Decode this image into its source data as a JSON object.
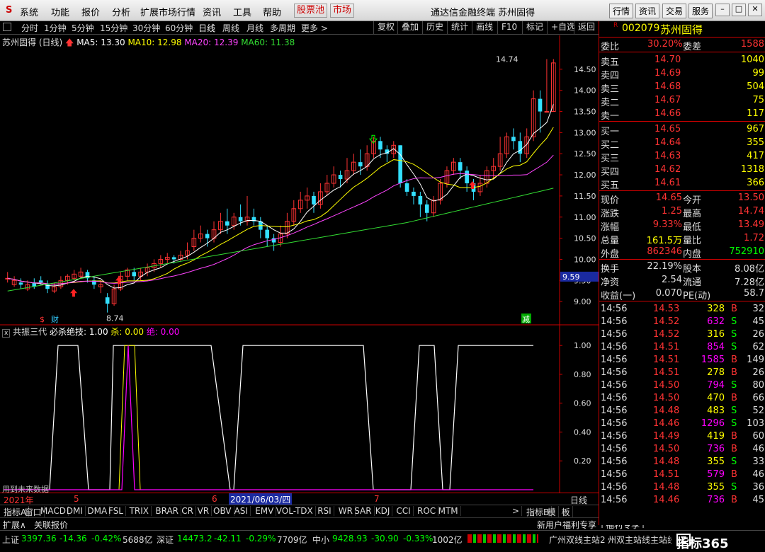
{
  "menu": {
    "items": [
      "系统",
      "功能",
      "报价",
      "分析",
      "扩展市场行情",
      "资讯",
      "工具",
      "帮助"
    ],
    "special": [
      "股票池",
      "市场"
    ],
    "title": "通达信金融终端  苏州固得",
    "right_buttons": [
      "行情",
      "资讯",
      "交易",
      "服务"
    ]
  },
  "toolbar": {
    "periods": [
      "分时",
      "1分钟",
      "5分钟",
      "15分钟",
      "30分钟",
      "60分钟",
      "日线",
      "周线",
      "月线",
      "多周期",
      "更多 >"
    ],
    "tools": [
      "复权",
      "叠加",
      "历史",
      "统计",
      "画线",
      "F10",
      "标记",
      "+自选",
      "返回"
    ]
  },
  "chart_header": {
    "name": "苏州固得 (日线)",
    "ma5": "MA5: 13.30",
    "ma10": "MA10: 12.98",
    "ma20": "MA20: 12.39",
    "ma60": "MA60: 11.38"
  },
  "price_axis": [
    "14.50",
    "14.00",
    "13.50",
    "13.00",
    "12.50",
    "12.00",
    "11.50",
    "11.00",
    "10.50",
    "10.00",
    "9.50",
    "9.00"
  ],
  "price_cursor": "9.59",
  "high_label": "14.74",
  "low_label": "8.74",
  "markers": {
    "s": "$",
    "cai": "财",
    "jian": "减"
  },
  "indicator_header": {
    "name": "共振三代",
    "bisha": "必杀绝技: 1.00",
    "sha": "杀: 0.00",
    "jue": "绝: 0.00"
  },
  "ind_axis": [
    "1.00",
    "0.80",
    "0.60",
    "0.40",
    "0.20"
  ],
  "ind_note": "用到未来数据",
  "date_axis": {
    "y2021": "2021年",
    "m5": "5",
    "m6": "6",
    "cursor_date": "2021/06/03/四",
    "m7": "7",
    "period": "日线"
  },
  "bottom_tabs": [
    "指标A",
    "窗口",
    "MACD",
    "DMI",
    "DMA",
    "FSL",
    "TRIX",
    "BRAR",
    "CR",
    "VR",
    "OBV",
    "ASI",
    "EMV",
    "VOL-TDX",
    "RSI",
    "WR",
    "SAR",
    "KDJ",
    "CCI",
    "ROC",
    "MTM",
    ">",
    "指标B",
    "模",
    "板"
  ],
  "bottom_row2": [
    "扩展∧",
    "关联报价"
  ],
  "bottom_ticker": "新用户福利专享",
  "stock": {
    "code": "002079",
    "name": "苏州固得",
    "flag": "R"
  },
  "weibi": {
    "label": "委比",
    "value": "30.20%",
    "wc_label": "委差",
    "wc_value": "1588"
  },
  "sell": [
    {
      "label": "卖五",
      "price": "14.70",
      "vol": "1040"
    },
    {
      "label": "卖四",
      "price": "14.69",
      "vol": "99"
    },
    {
      "label": "卖三",
      "price": "14.68",
      "vol": "504"
    },
    {
      "label": "卖二",
      "price": "14.67",
      "vol": "75"
    },
    {
      "label": "卖一",
      "price": "14.66",
      "vol": "117"
    }
  ],
  "buy": [
    {
      "label": "买一",
      "price": "14.65",
      "vol": "967"
    },
    {
      "label": "买二",
      "price": "14.64",
      "vol": "355"
    },
    {
      "label": "买三",
      "price": "14.63",
      "vol": "417"
    },
    {
      "label": "买四",
      "price": "14.62",
      "vol": "1318"
    },
    {
      "label": "买五",
      "price": "14.61",
      "vol": "366"
    }
  ],
  "quote": [
    {
      "l1": "现价",
      "v1": "14.65",
      "l2": "今开",
      "v2": "13.50",
      "c1": "#f33",
      "c2": "#f33"
    },
    {
      "l1": "涨跌",
      "v1": "1.25",
      "l2": "最高",
      "v2": "14.74",
      "c1": "#f33",
      "c2": "#f33"
    },
    {
      "l1": "涨幅",
      "v1": "9.33%",
      "l2": "最低",
      "v2": "13.49",
      "c1": "#f33",
      "c2": "#f33"
    },
    {
      "l1": "总量",
      "v1": "161.5万",
      "l2": "量比",
      "v2": "1.72",
      "c1": "#ff0",
      "c2": "#f33"
    },
    {
      "l1": "外盘",
      "v1": "862346",
      "l2": "内盘",
      "v2": "752910",
      "c1": "#f33",
      "c2": "#0f0"
    }
  ],
  "fund": [
    {
      "l1": "换手",
      "v1": "22.19%",
      "l2": "股本",
      "v2": "8.08亿"
    },
    {
      "l1": "净资",
      "v1": "2.54",
      "l2": "流通",
      "v2": "7.28亿"
    },
    {
      "l1": "收益(一)",
      "v1": "0.070",
      "l2": "PE(动)",
      "v2": "58.7"
    }
  ],
  "ticks": [
    {
      "t": "14:56",
      "p": "14.53",
      "v": "328",
      "bs": "B",
      "n": "32",
      "c": "#ff0"
    },
    {
      "t": "14:56",
      "p": "14.52",
      "v": "632",
      "bs": "S",
      "n": "45",
      "c": "#f0f"
    },
    {
      "t": "14:56",
      "p": "14.52",
      "v": "316",
      "bs": "S",
      "n": "26",
      "c": "#ff0"
    },
    {
      "t": "14:56",
      "p": "14.51",
      "v": "854",
      "bs": "S",
      "n": "62",
      "c": "#f0f"
    },
    {
      "t": "14:56",
      "p": "14.51",
      "v": "1585",
      "bs": "B",
      "n": "149",
      "c": "#f0f"
    },
    {
      "t": "14:56",
      "p": "14.51",
      "v": "278",
      "bs": "B",
      "n": "26",
      "c": "#ff0"
    },
    {
      "t": "14:56",
      "p": "14.50",
      "v": "794",
      "bs": "S",
      "n": "80",
      "c": "#f0f"
    },
    {
      "t": "14:56",
      "p": "14.50",
      "v": "470",
      "bs": "B",
      "n": "66",
      "c": "#ff0"
    },
    {
      "t": "14:56",
      "p": "14.48",
      "v": "483",
      "bs": "S",
      "n": "52",
      "c": "#ff0"
    },
    {
      "t": "14:56",
      "p": "14.46",
      "v": "1296",
      "bs": "S",
      "n": "103",
      "c": "#f0f"
    },
    {
      "t": "14:56",
      "p": "14.49",
      "v": "419",
      "bs": "B",
      "n": "60",
      "c": "#ff0"
    },
    {
      "t": "14:56",
      "p": "14.50",
      "v": "736",
      "bs": "B",
      "n": "46",
      "c": "#f0f"
    },
    {
      "t": "14:56",
      "p": "14.48",
      "v": "355",
      "bs": "S",
      "n": "33",
      "c": "#ff0"
    },
    {
      "t": "14:56",
      "p": "14.51",
      "v": "579",
      "bs": "B",
      "n": "46",
      "c": "#f0f"
    },
    {
      "t": "14:56",
      "p": "14.48",
      "v": "355",
      "bs": "S",
      "n": "36",
      "c": "#ff0"
    },
    {
      "t": "14:56",
      "p": "14.46",
      "v": "736",
      "bs": "B",
      "n": "45",
      "c": "#f0f"
    }
  ],
  "status": {
    "sh_label": "上证",
    "sh_val": "3397.36",
    "sh_chg": "-14.36",
    "sh_pct": "-0.42%",
    "sh_amt": "5688亿",
    "sz_label": "深证",
    "sz_val": "14473.2",
    "sz_chg": "-42.11",
    "sz_pct": "-0.29%",
    "sz_amt": "7709亿",
    "zx_label": "中小",
    "zx_val": "9428.93",
    "zx_chg": "-30.90",
    "zx_pct": "-0.33%",
    "zx_amt": "1002亿",
    "server": "广州双线主站2",
    "scroll": "州双主站线主站线主站线主站主站主站",
    "logo": "指标365"
  },
  "colors": {
    "up": "#ff3333",
    "down": "#33e0ff",
    "ma5": "#ffffff",
    "ma10": "#ffff00",
    "ma20": "#ff44ff",
    "ma60": "#33dd33"
  },
  "chart_data": {
    "type": "candlestick",
    "ylim": [
      8.6,
      15.0
    ],
    "candles": [
      [
        9.55,
        9.55,
        9.45,
        9.7
      ],
      [
        9.4,
        9.5,
        9.35,
        9.6
      ],
      [
        9.45,
        9.4,
        9.3,
        9.55
      ],
      [
        9.3,
        9.4,
        9.25,
        9.5
      ],
      [
        9.45,
        9.35,
        9.3,
        9.55
      ],
      [
        9.5,
        9.45,
        9.4,
        9.6
      ],
      [
        9.4,
        9.3,
        9.2,
        9.5
      ],
      [
        9.25,
        9.35,
        9.2,
        9.45
      ],
      [
        9.35,
        9.5,
        9.3,
        9.6
      ],
      [
        9.5,
        9.6,
        9.4,
        9.65
      ],
      [
        9.55,
        9.65,
        9.5,
        9.75
      ],
      [
        9.6,
        9.7,
        9.55,
        9.8
      ],
      [
        9.7,
        9.55,
        9.45,
        9.75
      ],
      [
        9.5,
        9.4,
        9.3,
        9.6
      ],
      [
        9.35,
        9.4,
        9.2,
        9.5
      ],
      [
        9.1,
        8.95,
        8.74,
        9.2
      ],
      [
        8.95,
        9.3,
        8.9,
        9.4
      ],
      [
        9.3,
        9.6,
        9.25,
        9.7
      ],
      [
        9.6,
        9.75,
        9.5,
        9.8
      ],
      [
        9.7,
        9.6,
        9.5,
        9.8
      ],
      [
        9.6,
        9.7,
        9.5,
        9.8
      ],
      [
        9.7,
        9.8,
        9.6,
        9.9
      ],
      [
        9.8,
        9.9,
        9.7,
        10.0
      ],
      [
        9.9,
        10.0,
        9.8,
        10.1
      ],
      [
        10.0,
        10.05,
        9.9,
        10.15
      ],
      [
        10.05,
        10.0,
        9.9,
        10.1
      ],
      [
        10.0,
        10.1,
        9.95,
        10.2
      ],
      [
        10.1,
        10.2,
        10.0,
        10.4
      ],
      [
        10.3,
        10.5,
        10.2,
        10.7
      ],
      [
        10.5,
        10.6,
        10.4,
        10.8
      ],
      [
        10.6,
        10.5,
        10.3,
        10.7
      ],
      [
        10.5,
        10.7,
        10.4,
        10.9
      ],
      [
        10.7,
        10.9,
        10.6,
        11.1
      ],
      [
        10.9,
        10.8,
        10.6,
        11.2
      ],
      [
        10.8,
        11.0,
        10.7,
        11.1
      ],
      [
        11.0,
        10.9,
        10.8,
        11.3
      ],
      [
        10.9,
        11.0,
        10.8,
        11.5
      ],
      [
        11.0,
        10.9,
        10.8,
        11.2
      ],
      [
        10.9,
        10.7,
        10.5,
        11.0
      ],
      [
        10.7,
        10.5,
        10.3,
        10.8
      ],
      [
        10.5,
        10.4,
        10.2,
        10.6
      ],
      [
        10.4,
        10.6,
        10.3,
        10.8
      ],
      [
        10.6,
        10.9,
        10.5,
        11.1
      ],
      [
        10.9,
        11.2,
        10.8,
        11.4
      ],
      [
        11.2,
        11.4,
        11.1,
        11.6
      ],
      [
        11.4,
        11.5,
        11.2,
        11.7
      ],
      [
        11.5,
        11.3,
        11.1,
        11.6
      ],
      [
        11.3,
        11.6,
        11.2,
        11.8
      ],
      [
        11.6,
        11.8,
        11.5,
        12.0
      ],
      [
        11.8,
        12.0,
        11.7,
        12.2
      ],
      [
        12.0,
        11.9,
        11.7,
        12.1
      ],
      [
        11.9,
        12.1,
        11.8,
        12.4
      ],
      [
        12.1,
        12.3,
        12.0,
        12.5
      ],
      [
        12.3,
        12.2,
        12.0,
        12.6
      ],
      [
        12.2,
        12.5,
        12.1,
        12.7
      ],
      [
        12.5,
        12.8,
        12.4,
        12.9
      ],
      [
        12.8,
        12.6,
        12.4,
        12.9
      ],
      [
        12.6,
        12.5,
        12.3,
        12.7
      ],
      [
        12.5,
        12.7,
        12.4,
        12.8
      ],
      [
        12.7,
        11.8,
        11.7,
        12.7
      ],
      [
        11.8,
        11.6,
        11.5,
        11.9
      ],
      [
        11.6,
        11.5,
        11.3,
        11.7
      ],
      [
        11.5,
        11.3,
        11.0,
        11.6
      ],
      [
        11.3,
        11.1,
        10.9,
        11.4
      ],
      [
        11.1,
        11.4,
        11.0,
        11.5
      ],
      [
        11.4,
        11.8,
        11.3,
        11.9
      ],
      [
        11.8,
        12.1,
        11.7,
        12.2
      ],
      [
        12.1,
        12.3,
        12.0,
        12.4
      ],
      [
        12.3,
        12.1,
        11.9,
        12.4
      ],
      [
        12.1,
        11.8,
        11.6,
        12.2
      ],
      [
        11.8,
        11.6,
        11.4,
        11.9
      ],
      [
        11.6,
        11.8,
        11.5,
        12.0
      ],
      [
        11.8,
        12.1,
        11.7,
        12.2
      ],
      [
        12.1,
        12.2,
        11.9,
        12.4
      ],
      [
        12.2,
        12.5,
        12.1,
        12.9
      ],
      [
        12.5,
        12.9,
        12.4,
        13.0
      ],
      [
        12.9,
        12.8,
        12.6,
        13.1
      ],
      [
        12.8,
        12.5,
        12.3,
        13.0
      ],
      [
        12.5,
        12.9,
        12.4,
        13.1
      ],
      [
        12.9,
        13.8,
        12.8,
        14.0
      ],
      [
        13.8,
        13.5,
        13.0,
        14.0
      ],
      [
        13.5,
        13.5,
        13.49,
        14.74
      ],
      [
        13.5,
        14.65,
        13.49,
        14.74
      ]
    ],
    "ma_series": [
      "MA5",
      "MA10",
      "MA20",
      "MA60"
    ],
    "indicator": {
      "name": "共振三代",
      "ylim": [
        0,
        1.05
      ]
    }
  }
}
